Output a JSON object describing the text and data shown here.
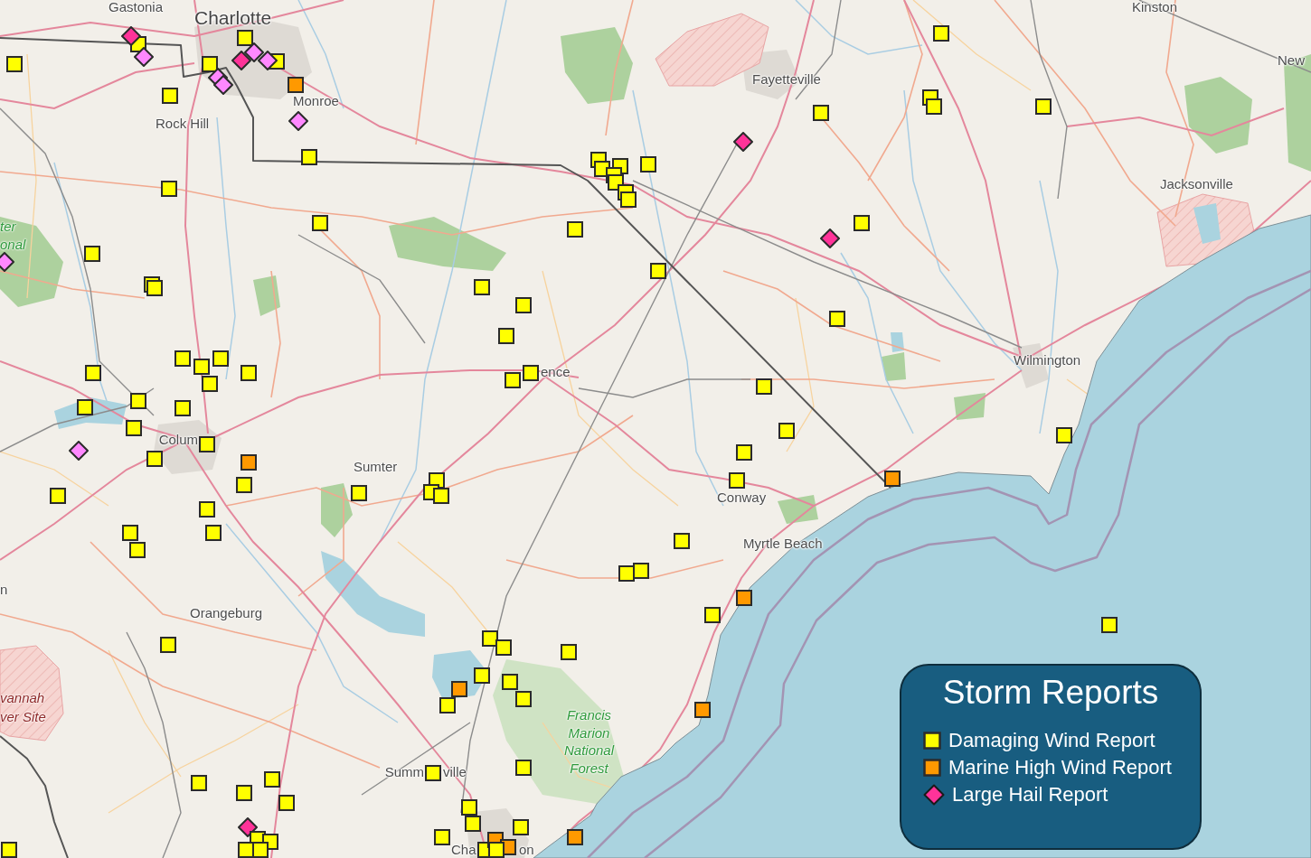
{
  "map_labels": [
    {
      "text": "Gastonia",
      "kind": "city"
    },
    {
      "text": "Kinston",
      "kind": "city"
    },
    {
      "text": "Charlotte",
      "kind": "large-city"
    },
    {
      "text": "New",
      "kind": "city"
    },
    {
      "text": "Fayetteville",
      "kind": "city"
    },
    {
      "text": "Monroe",
      "kind": "city"
    },
    {
      "text": "Rock Hill",
      "kind": "city"
    },
    {
      "text": "Jacksonville",
      "kind": "city"
    },
    {
      "text": "ter",
      "kind": "forest"
    },
    {
      "text": "onal",
      "kind": "forest"
    },
    {
      "text": "Wilmington",
      "kind": "city"
    },
    {
      "text": "ence",
      "kind": "city"
    },
    {
      "text": "Colum",
      "kind": "city"
    },
    {
      "text": "Sumter",
      "kind": "city"
    },
    {
      "text": "Conway",
      "kind": "city"
    },
    {
      "text": "Myrtle Beach",
      "kind": "city"
    },
    {
      "text": "n",
      "kind": "city"
    },
    {
      "text": "Orangeburg",
      "kind": "city"
    },
    {
      "text": "vannah",
      "kind": "restricted-area"
    },
    {
      "text": "ver Site",
      "kind": "restricted-area"
    },
    {
      "text": "Francis Marion National Forest",
      "kind": "forest"
    },
    {
      "text": "Summ",
      "kind": "city"
    },
    {
      "text": "ville",
      "kind": "city"
    },
    {
      "text": "Cha",
      "kind": "city"
    },
    {
      "text": "on",
      "kind": "city"
    }
  ],
  "markers": [
    {
      "kind": "square",
      "color": "#ffff00"
    },
    {
      "kind": "diamond",
      "color": "#ff3399"
    },
    {
      "kind": "diamond",
      "color": "#ff88ff"
    },
    {
      "kind": "square",
      "color": "#ffff00"
    },
    {
      "kind": "square",
      "color": "#ffff00"
    },
    {
      "kind": "square",
      "color": "#ffff00"
    },
    {
      "kind": "diamond",
      "color": "#ff88ff"
    },
    {
      "kind": "diamond",
      "color": "#ff3399"
    },
    {
      "kind": "diamond",
      "color": "#ff88ff"
    },
    {
      "kind": "square",
      "color": "#ffff00"
    },
    {
      "kind": "diamond",
      "color": "#ff88ff"
    },
    {
      "kind": "diamond",
      "color": "#ff88ff"
    },
    {
      "kind": "square",
      "color": "#ff9900"
    },
    {
      "kind": "square",
      "color": "#ffff00"
    },
    {
      "kind": "diamond",
      "color": "#ff88ff"
    },
    {
      "kind": "square",
      "color": "#ffff00"
    },
    {
      "kind": "square",
      "color": "#ffff00"
    },
    {
      "kind": "square",
      "color": "#ffff00"
    },
    {
      "kind": "square",
      "color": "#ffff00"
    },
    {
      "kind": "diamond",
      "color": "#ff88ff"
    },
    {
      "kind": "square",
      "color": "#ffff00"
    },
    {
      "kind": "square",
      "color": "#ffff00"
    },
    {
      "kind": "square",
      "color": "#ffff00"
    },
    {
      "kind": "square",
      "color": "#ffff00"
    },
    {
      "kind": "square",
      "color": "#ffff00"
    },
    {
      "kind": "square",
      "color": "#ffff00"
    },
    {
      "kind": "square",
      "color": "#ffff00"
    },
    {
      "kind": "square",
      "color": "#ffff00"
    },
    {
      "kind": "square",
      "color": "#ffff00"
    },
    {
      "kind": "square",
      "color": "#ffff00"
    },
    {
      "kind": "square",
      "color": "#ffff00"
    },
    {
      "kind": "square",
      "color": "#ffff00"
    },
    {
      "kind": "diamond",
      "color": "#ff88ff"
    },
    {
      "kind": "square",
      "color": "#ffff00"
    },
    {
      "kind": "square",
      "color": "#ffff00"
    },
    {
      "kind": "square",
      "color": "#ff9900"
    },
    {
      "kind": "square",
      "color": "#ffff00"
    },
    {
      "kind": "square",
      "color": "#ffff00"
    },
    {
      "kind": "square",
      "color": "#ffff00"
    },
    {
      "kind": "square",
      "color": "#ffff00"
    },
    {
      "kind": "square",
      "color": "#ffff00"
    },
    {
      "kind": "square",
      "color": "#ffff00"
    },
    {
      "kind": "square",
      "color": "#ffff00"
    },
    {
      "kind": "square",
      "color": "#ffff00"
    },
    {
      "kind": "square",
      "color": "#ffff00"
    },
    {
      "kind": "square",
      "color": "#ffff00"
    },
    {
      "kind": "square",
      "color": "#ffff00"
    },
    {
      "kind": "square",
      "color": "#ffff00"
    },
    {
      "kind": "square",
      "color": "#ffff00"
    },
    {
      "kind": "square",
      "color": "#ffff00"
    },
    {
      "kind": "square",
      "color": "#ffff00"
    },
    {
      "kind": "square",
      "color": "#ffff00"
    },
    {
      "kind": "square",
      "color": "#ffff00"
    },
    {
      "kind": "square",
      "color": "#ffff00"
    },
    {
      "kind": "square",
      "color": "#ffff00"
    },
    {
      "kind": "diamond",
      "color": "#ff3399"
    },
    {
      "kind": "square",
      "color": "#ffff00"
    },
    {
      "kind": "diamond",
      "color": "#ff3399"
    },
    {
      "kind": "square",
      "color": "#ffff00"
    },
    {
      "kind": "square",
      "color": "#ffff00"
    },
    {
      "kind": "square",
      "color": "#ffff00"
    },
    {
      "kind": "square",
      "color": "#ffff00"
    },
    {
      "kind": "square",
      "color": "#ffff00"
    },
    {
      "kind": "square",
      "color": "#ffff00"
    },
    {
      "kind": "square",
      "color": "#ffff00"
    },
    {
      "kind": "square",
      "color": "#ffff00"
    },
    {
      "kind": "square",
      "color": "#ffff00"
    },
    {
      "kind": "square",
      "color": "#ffff00"
    },
    {
      "kind": "square",
      "color": "#ffff00"
    },
    {
      "kind": "square",
      "color": "#ffff00"
    },
    {
      "kind": "square",
      "color": "#ffff00"
    },
    {
      "kind": "square",
      "color": "#ffff00"
    },
    {
      "kind": "square",
      "color": "#ffff00"
    },
    {
      "kind": "square",
      "color": "#ffff00"
    },
    {
      "kind": "square",
      "color": "#ffff00"
    },
    {
      "kind": "square",
      "color": "#ffff00"
    },
    {
      "kind": "square",
      "color": "#ff9900"
    },
    {
      "kind": "square",
      "color": "#ffff00"
    },
    {
      "kind": "square",
      "color": "#ffff00"
    },
    {
      "kind": "square",
      "color": "#ffff00"
    },
    {
      "kind": "square",
      "color": "#ff9900"
    },
    {
      "kind": "square",
      "color": "#ffff00"
    },
    {
      "kind": "square",
      "color": "#ffff00"
    },
    {
      "kind": "square",
      "color": "#ffff00"
    },
    {
      "kind": "square",
      "color": "#ffff00"
    },
    {
      "kind": "square",
      "color": "#ffff00"
    },
    {
      "kind": "square",
      "color": "#ffff00"
    },
    {
      "kind": "square",
      "color": "#ffff00"
    },
    {
      "kind": "square",
      "color": "#ffff00"
    },
    {
      "kind": "square",
      "color": "#ff9900"
    },
    {
      "kind": "square",
      "color": "#ffff00"
    },
    {
      "kind": "square",
      "color": "#ff9900"
    },
    {
      "kind": "square",
      "color": "#ffff00"
    },
    {
      "kind": "square",
      "color": "#ffff00"
    },
    {
      "kind": "square",
      "color": "#ffff00"
    },
    {
      "kind": "square",
      "color": "#ffff00"
    },
    {
      "kind": "square",
      "color": "#ffff00"
    },
    {
      "kind": "square",
      "color": "#ffff00"
    },
    {
      "kind": "square",
      "color": "#ff9900"
    },
    {
      "kind": "square",
      "color": "#ffff00"
    },
    {
      "kind": "square",
      "color": "#ffff00"
    },
    {
      "kind": "square",
      "color": "#ffff00"
    },
    {
      "kind": "square",
      "color": "#ffff00"
    },
    {
      "kind": "diamond",
      "color": "#ff3399"
    },
    {
      "kind": "square",
      "color": "#ffff00"
    },
    {
      "kind": "square",
      "color": "#ffff00"
    },
    {
      "kind": "square",
      "color": "#ffff00"
    },
    {
      "kind": "square",
      "color": "#ffff00"
    },
    {
      "kind": "square",
      "color": "#ffff00"
    },
    {
      "kind": "square",
      "color": "#ffff00"
    },
    {
      "kind": "square",
      "color": "#ff9900"
    },
    {
      "kind": "square",
      "color": "#ff9900"
    },
    {
      "kind": "square",
      "color": "#ffff00"
    }
  ],
  "legend": {
    "title": "Storm Reports",
    "items": [
      {
        "label": "Damaging Wind Report",
        "kind": "square",
        "color": "#ffff00"
      },
      {
        "label": "Marine High Wind Report",
        "kind": "square",
        "color": "#ff9900"
      },
      {
        "label": "Large Hail Report",
        "kind": "diamond",
        "color": "#ff3399"
      }
    ]
  }
}
